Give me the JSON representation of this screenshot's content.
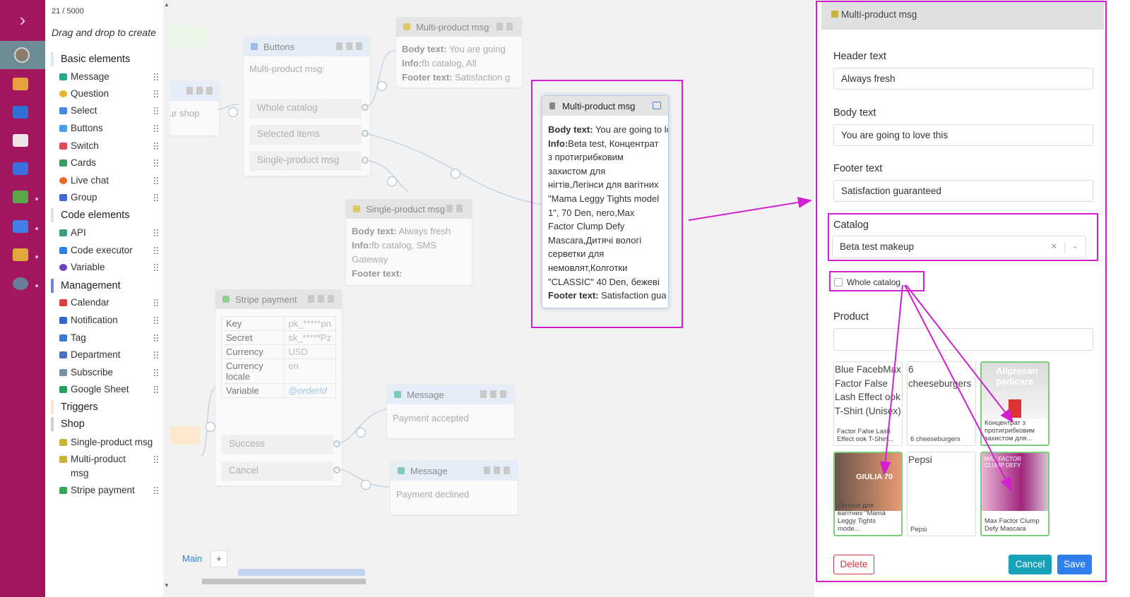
{
  "sidebar": {
    "counter": "21 / 5000",
    "hint": "Drag and drop to create",
    "sections": {
      "basic": "Basic elements",
      "code": "Code elements",
      "management": "Management",
      "triggers": "Triggers",
      "shop": "Shop"
    },
    "items": {
      "message": "Message",
      "question": "Question",
      "select": "Select",
      "buttons": "Buttons",
      "switch": "Switch",
      "cards": "Cards",
      "live_chat": "Live chat",
      "group": "Group",
      "api": "API",
      "code_executor": "Code executor",
      "variable": "Variable",
      "calendar": "Calendar",
      "notification": "Notification",
      "tag": "Tag",
      "department": "Department",
      "subscribe": "Subscribe",
      "google_sheet": "Google Sheet",
      "single_product": "Single-product msg",
      "multi_product": "Multi-product msg",
      "stripe_payment": "Stripe payment"
    }
  },
  "canvas": {
    "partial_label": "ur shop",
    "buttons_node": {
      "title": "Buttons",
      "body": "Multi-product msg:",
      "ports": [
        "Whole catalog",
        "Selected items",
        "Single-product msg"
      ]
    },
    "multi_top": {
      "title": "Multi-product msg",
      "body_label": "Body text:",
      "body_value": " You are going",
      "info_label": "Info:",
      "info_value": "fb catalog, All",
      "footer_label": "Footer text:",
      "footer_value": " Satisfaction g"
    },
    "single_node": {
      "title": "Single-product msg",
      "body_label": "Body text:",
      "body_value": " Always fresh",
      "info_label": "Info:",
      "info_value": "fb catalog, SMS Gateway",
      "footer_label": "Footer text:"
    },
    "focus_node": {
      "title": "Multi-product msg",
      "body_label": "Body text:",
      "body_value": " You are going to lo",
      "info_label": "Info:",
      "info_value": "Beta test, Концентрат з протигрибковим захистом для нігтів,Легінси для вагітних \"Mama Leggy Tights model 1\", 70 Den, nero,Max Factor Clump Defy Mascara,Дитячі вологі серветки для немовлят,Колготки \"CLASSIC\" 40 Den, бежеві",
      "footer_label": "Footer text:",
      "footer_value": " Satisfaction gua"
    },
    "stripe_node": {
      "title": "Stripe payment",
      "rows": [
        {
          "key": "Key",
          "value": "pk_*****pn"
        },
        {
          "key": "Secret",
          "value": "sk_*****Pz"
        },
        {
          "key": "Currency",
          "value": "USD"
        },
        {
          "key": "Currency locale",
          "value": "en"
        },
        {
          "key": "Variable",
          "value": "@orderId"
        }
      ],
      "ports": [
        "Success",
        "Cancel"
      ]
    },
    "message_accepted": {
      "title": "Message",
      "body": "Payment accepted"
    },
    "message_declined": {
      "title": "Message",
      "body": "Payment declined"
    },
    "tabs": {
      "main": "Main",
      "add": "+"
    }
  },
  "panel": {
    "title": "Multi-product msg",
    "header_label": "Header text",
    "header_value": "Always fresh",
    "body_label": "Body text",
    "body_value": "You are going to love this",
    "footer_label": "Footer text",
    "footer_value": "Satisfaction guaranteed",
    "catalog_label": "Catalog",
    "catalog_value": "Beta test makeup",
    "clear_glyph": "×",
    "whole_catalog_label": "Whole catalog",
    "product_label": "Product",
    "product_value": "",
    "products": [
      {
        "alt": "Blue FacebMax Factor False Lash Effect ook T-Shirt (Unisex)",
        "caption": "Factor False Lash Effect ook T-Shirt...",
        "selected": false
      },
      {
        "alt": "6 cheeseburgers",
        "caption": "6 cheeseburgers",
        "selected": false
      },
      {
        "alt": "",
        "caption": "Концентрат з протигрибковим захистом для...",
        "selected": true,
        "image_text": "Allpresan pedicare"
      },
      {
        "alt": "",
        "caption": "Легінси для вагітних \"Mama Leggy Tights mode...",
        "selected": true,
        "image_text": "GIULIA 70"
      },
      {
        "alt": "Pepsi",
        "caption": "Pepsi",
        "selected": false
      },
      {
        "alt": "",
        "caption": "Max Factor Clump Defy Mascara",
        "selected": true,
        "image_text": "MAX FACTOR CLUMP DEFY"
      }
    ],
    "buttons": {
      "delete": "Delete",
      "cancel": "Cancel",
      "save": "Save"
    }
  },
  "colors": {
    "rail": "#a3175f",
    "annotation": "#d11fd1",
    "cancel": "#17a2b8",
    "save": "#2f80ed",
    "delete": "#dc3545"
  }
}
